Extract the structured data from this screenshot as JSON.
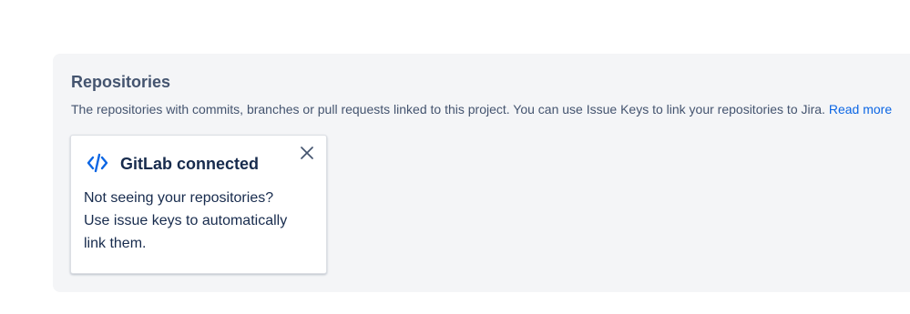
{
  "repositories": {
    "title": "Repositories",
    "description": "The repositories with commits, branches or pull requests linked to this project. You can use Issue Keys to link your repositories to Jira.",
    "read_more_label": "Read more"
  },
  "connection_card": {
    "icon": "code-icon",
    "title": "GitLab connected",
    "body": "Not seeing your repositories? Use issue keys to automatically link them.",
    "close_icon": "close-icon"
  },
  "colors": {
    "panel_background": "#f4f5f7",
    "heading_text": "#44546f",
    "link": "#0c66e4",
    "card_text": "#172b4d",
    "icon_blue": "#0c66e4"
  }
}
